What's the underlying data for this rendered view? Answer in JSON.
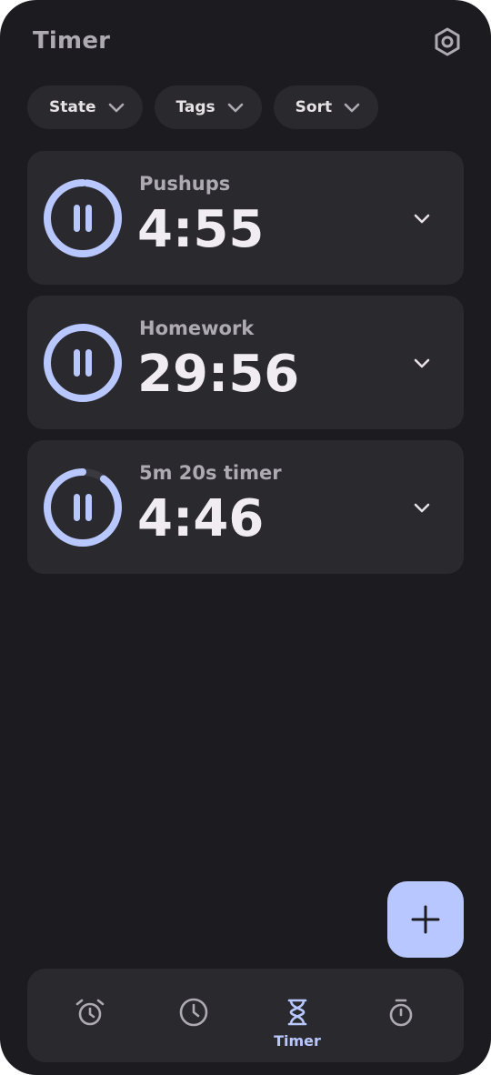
{
  "header": {
    "title": "Timer",
    "settings_icon": "settings-gear-icon"
  },
  "filters": [
    {
      "label": "State",
      "icon": "chevron-down-icon"
    },
    {
      "label": "Tags",
      "icon": "chevron-down-icon"
    },
    {
      "label": "Sort",
      "icon": "chevron-down-icon"
    }
  ],
  "timers": [
    {
      "name": "Pushups",
      "time": "4:55",
      "progress": 0.98,
      "state": "running",
      "icon": "pause-icon"
    },
    {
      "name": "Homework",
      "time": "29:56",
      "progress": 0.995,
      "state": "running",
      "icon": "pause-icon"
    },
    {
      "name": "5m 20s timer",
      "time": "4:46",
      "progress": 0.9,
      "state": "running",
      "icon": "pause-icon"
    }
  ],
  "fab": {
    "icon": "plus-icon"
  },
  "bottom_nav": [
    {
      "icon": "alarm-icon",
      "label": "",
      "active": false
    },
    {
      "icon": "clock-icon",
      "label": "",
      "active": false
    },
    {
      "icon": "hourglass-icon",
      "label": "Timer",
      "active": true
    },
    {
      "icon": "stopwatch-icon",
      "label": "",
      "active": false
    }
  ],
  "colors": {
    "background": "#1c1b1f",
    "card": "#2a292d",
    "accent": "#b8c7ff",
    "text_muted": "#aeaab2"
  }
}
